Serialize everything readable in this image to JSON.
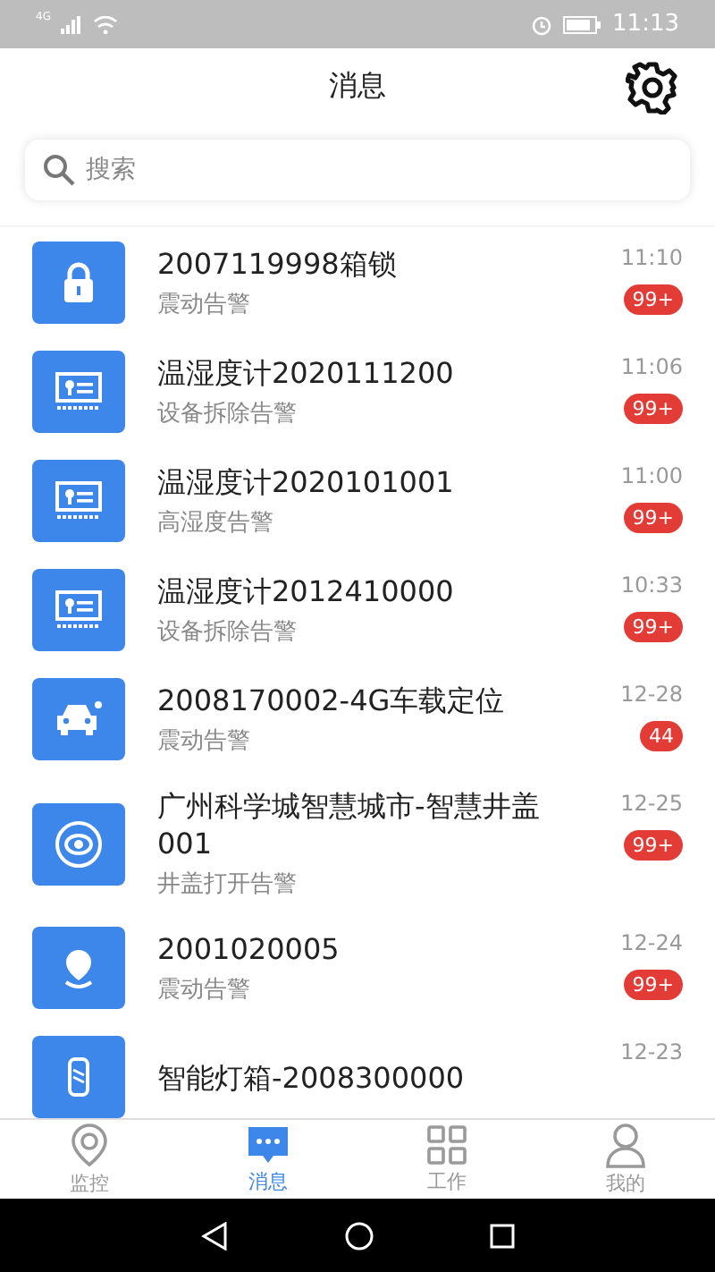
{
  "status_bar": {
    "network": "4G",
    "time": "11:13"
  },
  "header": {
    "title": "消息"
  },
  "search": {
    "placeholder": "搜索"
  },
  "messages": [
    {
      "kind": "lock",
      "title": "2007119998箱锁",
      "subtitle": "震动告警",
      "time": "11:10",
      "badge": "99+"
    },
    {
      "kind": "meter",
      "title": "温湿度计2020111200",
      "subtitle": "设备拆除告警",
      "time": "11:06",
      "badge": "99+"
    },
    {
      "kind": "meter",
      "title": "温湿度计2020101001",
      "subtitle": "高湿度告警",
      "time": "11:00",
      "badge": "99+"
    },
    {
      "kind": "meter",
      "title": "温湿度计2012410000",
      "subtitle": "设备拆除告警",
      "time": "10:33",
      "badge": "99+"
    },
    {
      "kind": "car",
      "title": "2008170002-4G车载定位",
      "subtitle": "震动告警",
      "time": "12-28",
      "badge": "44"
    },
    {
      "kind": "cover",
      "title": "广州科学城智慧城市-智慧井盖001",
      "subtitle": "井盖打开告警",
      "time": "12-25",
      "badge": "99+"
    },
    {
      "kind": "pin",
      "title": "2001020005",
      "subtitle": "震动告警",
      "time": "12-24",
      "badge": "99+"
    },
    {
      "kind": "lamp",
      "title": "智能灯箱-2008300000",
      "time": "12-23"
    }
  ],
  "tabs": [
    {
      "kind": "monitor",
      "label": "监控",
      "selected": false
    },
    {
      "kind": "message",
      "label": "消息",
      "selected": true
    },
    {
      "kind": "work",
      "label": "工作",
      "selected": false
    },
    {
      "kind": "me",
      "label": "我的",
      "selected": false
    }
  ]
}
